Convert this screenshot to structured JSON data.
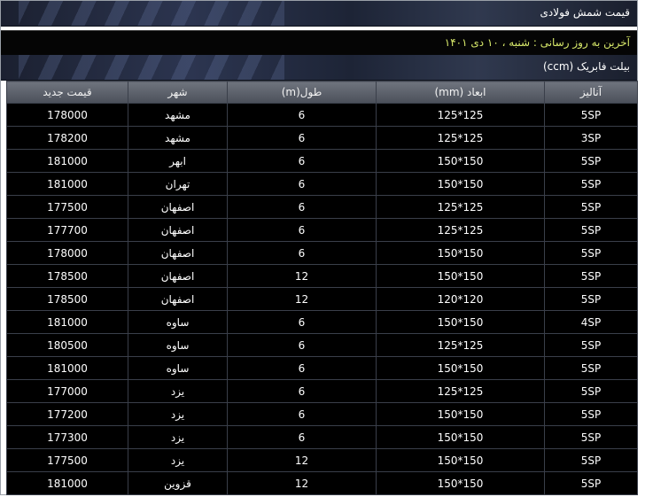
{
  "header": {
    "title": "قیمت شمش فولادی",
    "last_update": "آخرین به روز رسانی : شنبه ، ۱۰ دی ۱۴۰۱",
    "section_title": "بیلت فابریک (ccm)"
  },
  "colors": {
    "banner": "#2c3550",
    "row_background": "#000000",
    "header_background": "#5c616b",
    "update_text": "#d7e86a"
  },
  "table": {
    "columns": [
      "آنالیز",
      "ابعاد (mm)",
      "طول(m)",
      "شهر",
      "قیمت جدید"
    ],
    "rows": [
      [
        "5SP",
        "125*125",
        "6",
        "مشهد",
        "178000"
      ],
      [
        "3SP",
        "125*125",
        "6",
        "مشهد",
        "178200"
      ],
      [
        "5SP",
        "150*150",
        "6",
        "ابهر",
        "181000"
      ],
      [
        "5SP",
        "150*150",
        "6",
        "تهران",
        "181000"
      ],
      [
        "5SP",
        "125*125",
        "6",
        "اصفهان",
        "177500"
      ],
      [
        "5SP",
        "125*125",
        "6",
        "اصفهان",
        "177700"
      ],
      [
        "5SP",
        "150*150",
        "6",
        "اصفهان",
        "178000"
      ],
      [
        "5SP",
        "150*150",
        "12",
        "اصفهان",
        "178500"
      ],
      [
        "5SP",
        "120*120",
        "12",
        "اصفهان",
        "178500"
      ],
      [
        "4SP",
        "150*150",
        "6",
        "ساوه",
        "181000"
      ],
      [
        "5SP",
        "125*125",
        "6",
        "ساوه",
        "180500"
      ],
      [
        "5SP",
        "150*150",
        "6",
        "ساوه",
        "181000"
      ],
      [
        "5SP",
        "125*125",
        "6",
        "یزد",
        "177000"
      ],
      [
        "5SP",
        "150*150",
        "6",
        "یزد",
        "177200"
      ],
      [
        "5SP",
        "150*150",
        "6",
        "یزد",
        "177300"
      ],
      [
        "5SP",
        "150*150",
        "12",
        "یزد",
        "177500"
      ],
      [
        "5SP",
        "150*150",
        "12",
        "قزوین",
        "181000"
      ]
    ]
  }
}
